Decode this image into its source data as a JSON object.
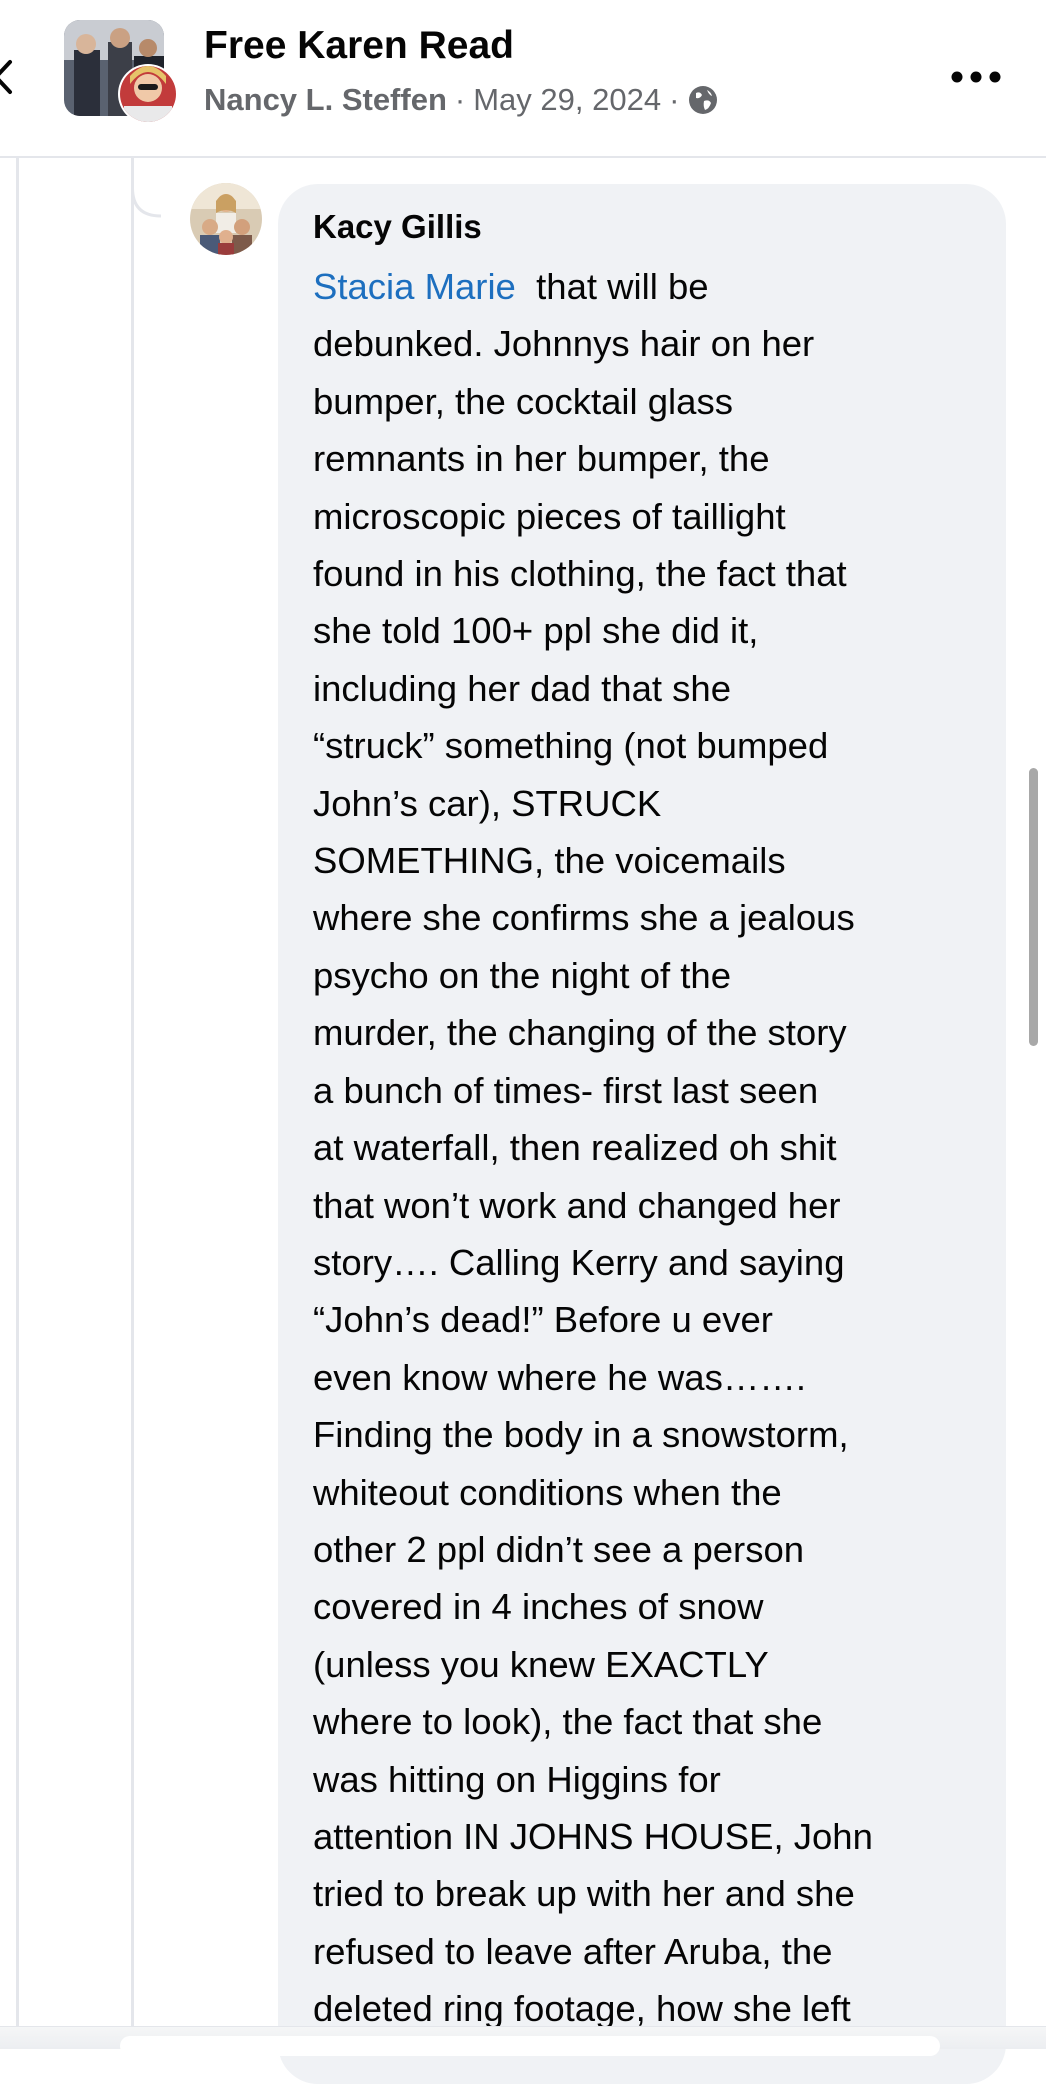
{
  "header": {
    "group_title": "Free Karen Read",
    "author": "Nancy L. Steffen",
    "separator": "·",
    "date": "May 29, 2024",
    "visibility_icon": "globe-icon",
    "back_icon": "chevron-left-icon",
    "more_icon": "more-options-icon"
  },
  "comment": {
    "author": "Kacy Gillis",
    "tag": "Stacia Marie",
    "lines": [
      "debunked. Johnnys hair on her",
      "bumper, the cocktail glass",
      "remnants in her bumper, the",
      "microscopic pieces of taillight",
      "found in his clothing, the fact that",
      "she told 100+ ppl she did it,",
      "including her dad that she",
      "“struck” something (not bumped",
      "John’s car), STRUCK",
      "SOMETHING, the voicemails",
      "where she confirms she a jealous",
      "psycho on the night of the",
      "murder, the changing of the story",
      "a bunch of times- first last seen",
      "at waterfall, then realized oh shit",
      "that won’t work and changed her",
      "story…. Calling Kerry and saying",
      "“John’s dead!”  Before u ever",
      "even know where he was…….",
      "Finding the body in a snowstorm,",
      "whiteout conditions when the",
      "other 2 ppl didn’t see a person",
      "covered in 4 inches of snow",
      "(unless you knew EXACTLY",
      "where to look), the fact that she",
      "was hitting on Higgins for",
      "attention IN JOHNS HOUSE, John",
      "tried to break up with her and she",
      "refused to leave after Aruba, the",
      "deleted ring footage, how she left"
    ],
    "first_line_rest": "that will be"
  },
  "colors": {
    "tag_link": "#1d6fbf",
    "bubble_bg": "#f0f2f5",
    "meta_text": "#65676b"
  }
}
